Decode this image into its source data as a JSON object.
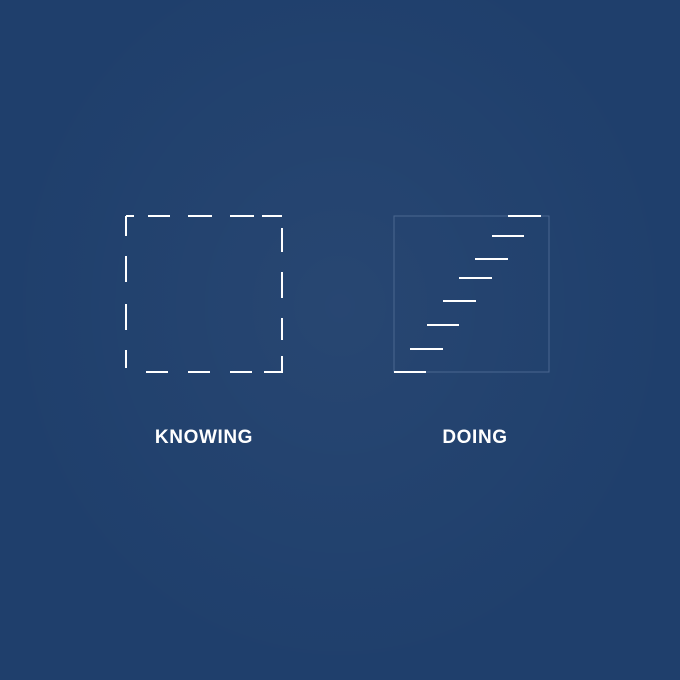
{
  "colors": {
    "background": "#1f3f6c",
    "stroke": "#ffffff",
    "faint_frame": "#4a6790"
  },
  "labels": {
    "knowing": "KNOWING",
    "doing": "DOING"
  },
  "icons": {
    "knowing": "dashed-square-icon",
    "doing": "staircase-icon"
  }
}
